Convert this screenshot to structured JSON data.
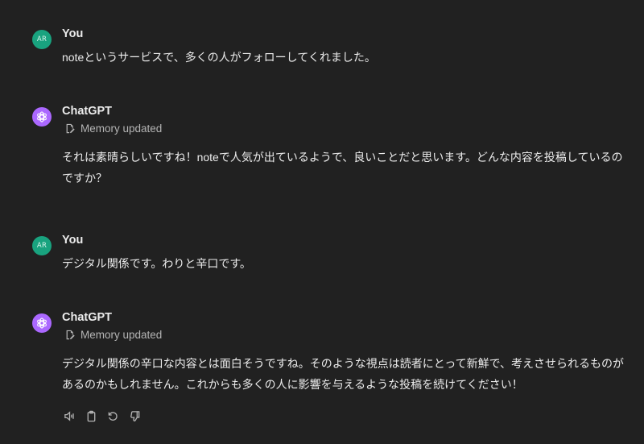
{
  "messages": [
    {
      "role": "user",
      "avatar_initials": "AR",
      "author": "You",
      "text": "noteというサービスで、多くの人がフォローしてくれました。"
    },
    {
      "role": "assistant",
      "author": "ChatGPT",
      "memory_label": "Memory updated",
      "text": "それは素晴らしいですね！noteで人気が出ているようで、良いことだと思います。どんな内容を投稿しているのですか？"
    },
    {
      "role": "user",
      "avatar_initials": "AR",
      "author": "You",
      "text": "デジタル関係です。わりと辛口です。"
    },
    {
      "role": "assistant",
      "author": "ChatGPT",
      "memory_label": "Memory updated",
      "text": "デジタル関係の辛口な内容とは面白そうですね。そのような視点は読者にとって新鮮で、考えさせられるものがあるのかもしれません。これからも多くの人に影響を与えるような投稿を続けてください！"
    }
  ],
  "actions": {
    "icons": [
      "speaker-icon",
      "copy-icon",
      "regenerate-icon",
      "thumbs-down-icon"
    ]
  },
  "colors": {
    "background": "#212121",
    "user_avatar": "#19a37f",
    "assistant_avatar": "#ab68ff",
    "text": "#ececec",
    "muted": "#b4b4b4"
  }
}
